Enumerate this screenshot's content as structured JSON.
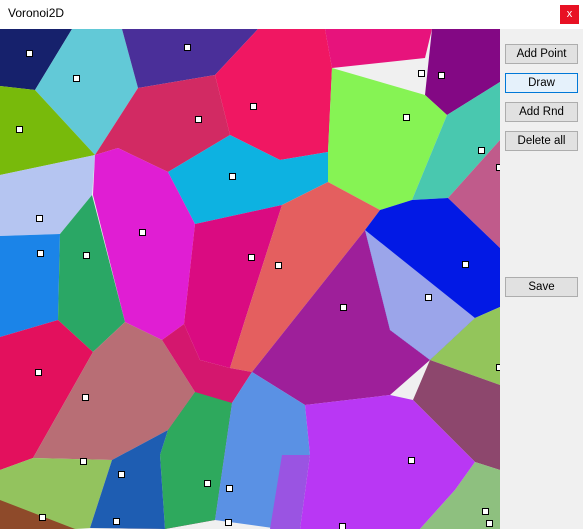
{
  "window": {
    "title": "Voronoi2D",
    "close_label": "x"
  },
  "toolbar": {
    "add_point_label": "Add Point",
    "draw_label": "Draw",
    "add_rnd_label": "Add Rnd",
    "delete_all_label": "Delete all",
    "save_label": "Save"
  }
}
